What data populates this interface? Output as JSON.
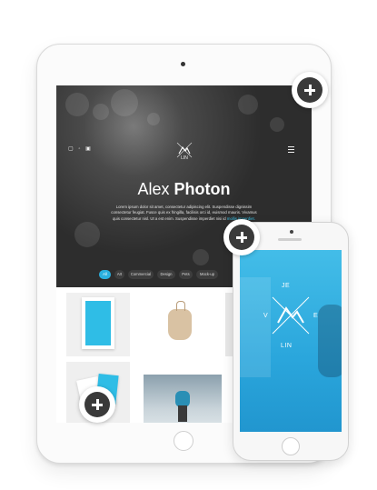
{
  "hero": {
    "title_light": "Alex",
    "title_bold": "Photon",
    "logo_text": "LIN",
    "description": "Lorem ipsum dolor sit amet, consectetur adipiscing elit. Suspendisse dignissim consectetur feugiat. Fusce quis ex fringilla, facilisis orci id, euismod mauris. Vivamus quis consectetur nisl. Ut a est enim. Suspendisse imperdiet nisi id ",
    "description_link": "mollis imperdiet."
  },
  "filters": [
    "All",
    "Art",
    "Commercial",
    "Design",
    "Pets",
    "Mock-up"
  ],
  "phone": {
    "logo_letters": {
      "top": "JE",
      "left": "V",
      "right": "E",
      "bottom": "LIN"
    }
  },
  "colors": {
    "accent": "#2ab0e0",
    "hero_bg": "#2d2d2d",
    "phone_screen": "#2aa6dc",
    "plus_button": "#3a3a3a"
  },
  "icons": [
    "plus-icon",
    "mountain-logo-icon",
    "menu-icon",
    "social-icons"
  ]
}
